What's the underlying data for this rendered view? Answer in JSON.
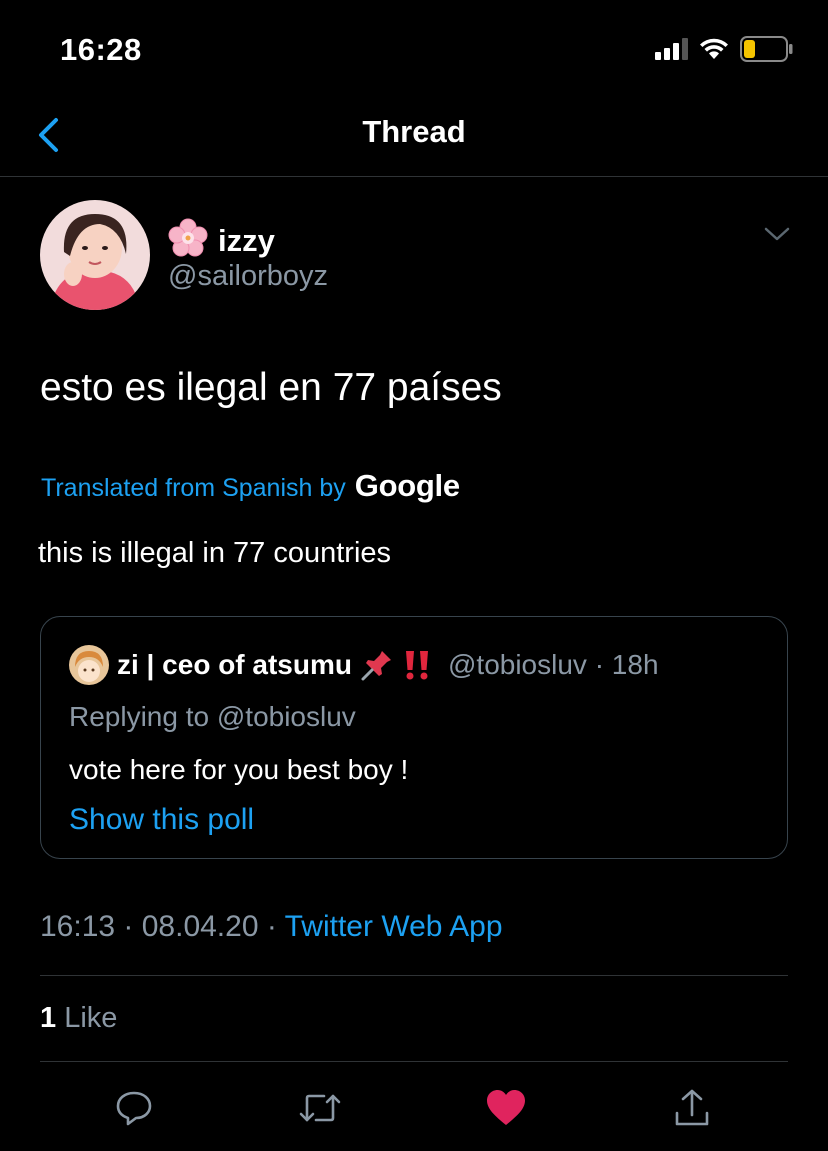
{
  "status_bar": {
    "time": "16:28",
    "icons": [
      "cellular-signal-icon",
      "wifi-icon",
      "battery-icon"
    ]
  },
  "nav": {
    "title": "Thread",
    "back_icon": "chevron-left-icon"
  },
  "tweet": {
    "author": {
      "display_name": "izzy",
      "name_emoji": "🌸",
      "handle": "@sailorboyz"
    },
    "text": "esto es ilegal en 77 países",
    "translation": {
      "label": "Translated from Spanish by",
      "provider": "Google",
      "text": "this is illegal in 77 countries"
    },
    "quoted": {
      "display_name": "zi | ceo of atsumu",
      "emojis": [
        "📌",
        "‼️"
      ],
      "handle_time": "@tobiosluv · 18h",
      "replying_to": "Replying to @tobiosluv",
      "text": "vote here for you best boy !",
      "poll_link": "Show this poll"
    },
    "timestamp": "16:13 · 08.04.20 · ",
    "source": "Twitter Web App",
    "like_count": "1",
    "like_label": " Like"
  },
  "actions": [
    {
      "name": "reply",
      "icon": "reply-icon"
    },
    {
      "name": "retweet",
      "icon": "retweet-icon"
    },
    {
      "name": "like",
      "icon": "heart-icon",
      "active": true
    },
    {
      "name": "share",
      "icon": "share-icon"
    }
  ],
  "colors": {
    "background": "#000000",
    "accent_blue": "#1da1f2",
    "secondary_text": "#8b98a5",
    "divider": "#2f3336",
    "like_red": "#e0245e"
  }
}
